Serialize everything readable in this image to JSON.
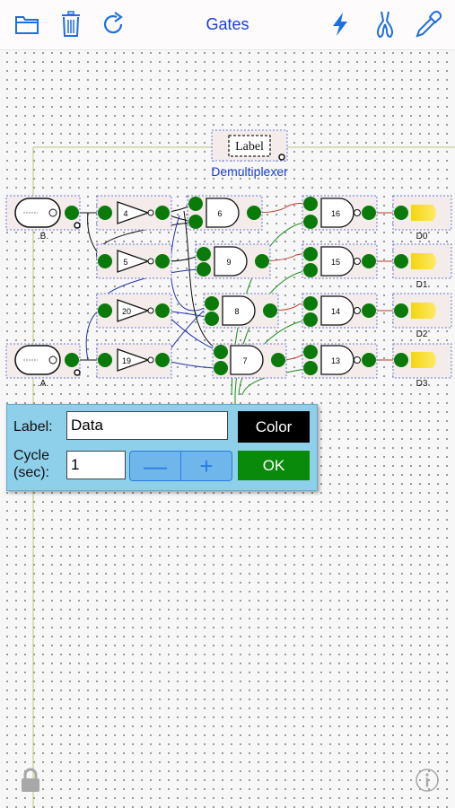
{
  "toolbar": {
    "title": "Gates",
    "icons": [
      "folder-icon",
      "trash-icon",
      "redo-icon",
      "lightning-icon",
      "wire-cutter-icon",
      "eyedropper-icon"
    ]
  },
  "circuit": {
    "label_box_text": "Label",
    "title_text": "Demultiplexer",
    "switch_b_label": ".B.",
    "switch_a_label": ".A.",
    "not_gates": [
      "4",
      "5",
      "20",
      "19"
    ],
    "and_gates_mid": [
      "6",
      "9",
      "8",
      "7"
    ],
    "nand_gates": [
      "16",
      "15",
      "14",
      "13"
    ],
    "outputs": [
      "D0",
      "D1",
      "D2",
      "D3"
    ]
  },
  "dialog": {
    "label_caption": "Label:",
    "label_value": "Data",
    "cycle_caption_1": "Cycle",
    "cycle_caption_2": "(sec):",
    "cycle_value": "1",
    "minus": "—",
    "plus": "+",
    "color_button": "Color",
    "ok_button": "OK"
  },
  "colors": {
    "title": "#1a3fd6",
    "node_green": "#0a7a0a",
    "dialog_bg": "#8ecfea",
    "ok_green": "#0a8a0a",
    "led_yellow": "#f4d50d"
  }
}
